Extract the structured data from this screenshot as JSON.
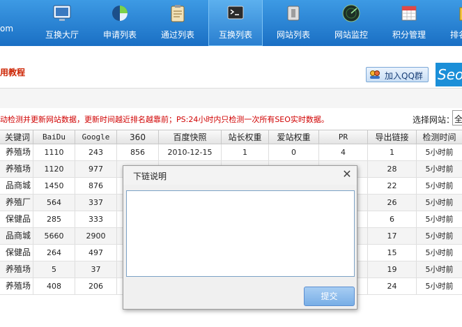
{
  "brand_fragment": "om",
  "nav": {
    "items": [
      {
        "label": "互换大厅",
        "icon": "monitor-icon"
      },
      {
        "label": "申请列表",
        "icon": "pie-chart-icon"
      },
      {
        "label": "通过列表",
        "icon": "clipboard-icon"
      },
      {
        "label": "互换列表",
        "icon": "terminal-icon",
        "active": true
      },
      {
        "label": "网站列表",
        "icon": "window-icon"
      },
      {
        "label": "网站监控",
        "icon": "radar-icon"
      },
      {
        "label": "积分管理",
        "icon": "calendar-icon"
      },
      {
        "label": "排名",
        "icon": "rank-icon"
      }
    ]
  },
  "subbar": {
    "tutorial_text": "用教程",
    "qq_button_label": "加入QQ群",
    "seo_badge": "Seo"
  },
  "notice": {
    "text": "动检测并更新网站数据，更新时间越近排名越靠前；PS:24小时内只检测一次所有SEO实时数据。",
    "select_label": "选择网站：",
    "select_value": "全"
  },
  "table": {
    "headers": [
      "关键词",
      "BaiDu",
      "Google",
      "360",
      "百度快照",
      "站长权重",
      "爱站权重",
      "PR",
      "导出链接",
      "检测时间"
    ],
    "rows": [
      [
        "养殖场",
        "1110",
        "243",
        "856",
        "2010-12-15",
        "1",
        "0",
        "4",
        "1",
        "5小时前"
      ],
      [
        "养殖场",
        "1120",
        "977",
        "",
        "",
        "",
        "",
        "",
        "28",
        "5小时前"
      ],
      [
        "品商城",
        "1450",
        "876",
        "",
        "",
        "",
        "",
        "",
        "22",
        "5小时前"
      ],
      [
        "养殖厂",
        "564",
        "337",
        "",
        "",
        "",
        "",
        "",
        "26",
        "5小时前"
      ],
      [
        "保健品",
        "285",
        "333",
        "",
        "",
        "",
        "",
        "",
        "6",
        "5小时前"
      ],
      [
        "品商城",
        "5660",
        "2900",
        "",
        "",
        "",
        "",
        "",
        "17",
        "5小时前"
      ],
      [
        "保健品",
        "264",
        "497",
        "",
        "",
        "",
        "",
        "",
        "15",
        "5小时前"
      ],
      [
        "养殖场",
        "5",
        "37",
        "",
        "",
        "",
        "",
        "",
        "19",
        "5小时前"
      ],
      [
        "养殖场",
        "408",
        "206",
        "",
        "",
        "",
        "",
        "",
        "24",
        "5小时前"
      ]
    ]
  },
  "modal": {
    "title": "下链说明",
    "close_glyph": "✕",
    "textarea_value": "",
    "submit_label": "提交"
  },
  "colors": {
    "nav_bg": "#2a83d6",
    "notice_red": "#d00000",
    "submit_blue": "#78aee6"
  }
}
